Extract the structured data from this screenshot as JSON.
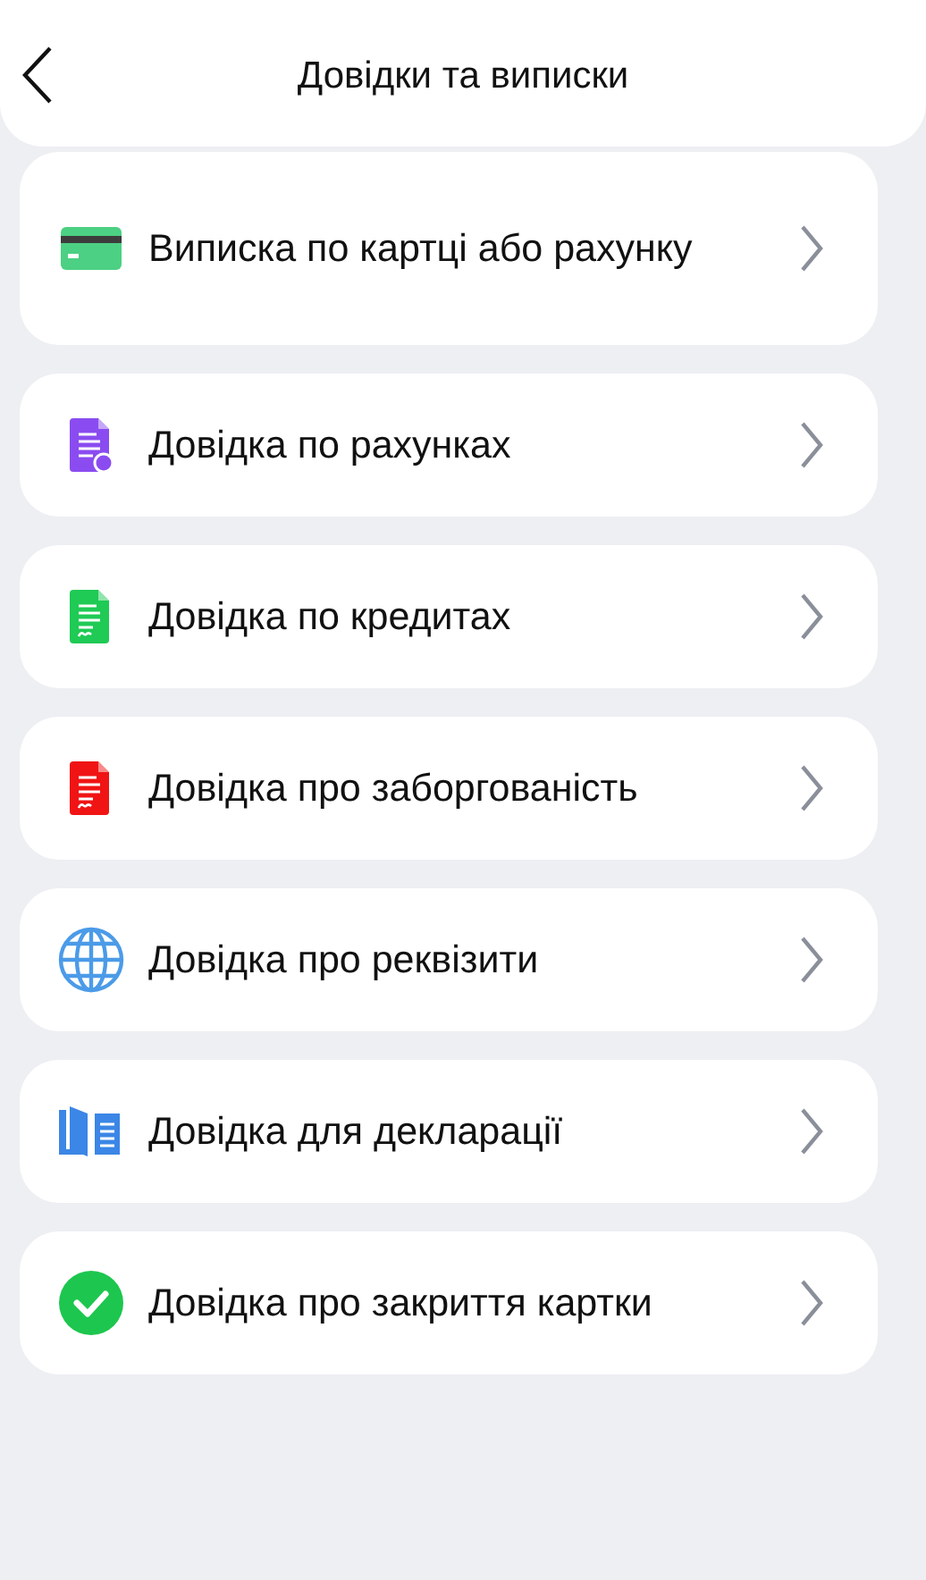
{
  "header": {
    "title": "Довідки та виписки"
  },
  "items": [
    {
      "kind": "card",
      "label": "Виписка по картці або рахунку"
    },
    {
      "kind": "doc-coin",
      "label": "Довідка по рахунках"
    },
    {
      "kind": "doc-green",
      "label": "Довідка по кредитах"
    },
    {
      "kind": "doc-red",
      "label": "Довідка про заборгованість"
    },
    {
      "kind": "globe",
      "label": "Довідка про реквізити"
    },
    {
      "kind": "book",
      "label": "Довідка для декларації"
    },
    {
      "kind": "check",
      "label": "Довідка про закриття картки"
    }
  ]
}
